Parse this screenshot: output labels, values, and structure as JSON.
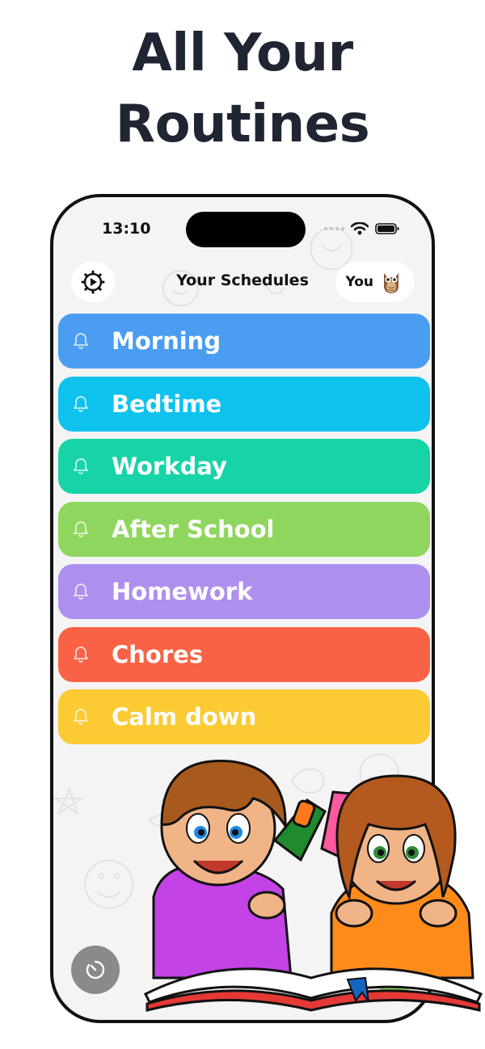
{
  "headline": {
    "line1": "All Your",
    "line2": "Routines"
  },
  "status_bar": {
    "time": "13:10",
    "icons": [
      "signal-dots-icon",
      "wifi-icon",
      "battery-icon"
    ]
  },
  "header": {
    "settings_icon": "gear-play-icon",
    "title": "Your Schedules",
    "user_label": "You",
    "user_avatar": "owl-avatar"
  },
  "routines": [
    {
      "label": "Morning",
      "color": "#4a9df0",
      "icon": "bell-icon"
    },
    {
      "label": "Bedtime",
      "color": "#0fc2ee",
      "icon": "bell-icon"
    },
    {
      "label": "Workday",
      "color": "#17d4a8",
      "icon": "bell-icon"
    },
    {
      "label": "After School",
      "color": "#8fd65e",
      "icon": "bell-icon"
    },
    {
      "label": "Homework",
      "color": "#ae8fee",
      "icon": "bell-icon"
    },
    {
      "label": "Chores",
      "color": "#fa6245",
      "icon": "bell-icon"
    },
    {
      "label": "Calm down",
      "color": "#fcca33",
      "icon": "bell-icon"
    }
  ],
  "bottom": {
    "timer_icon": "timer-icon",
    "add_label": "+"
  },
  "illustration": "kids-reading-book"
}
